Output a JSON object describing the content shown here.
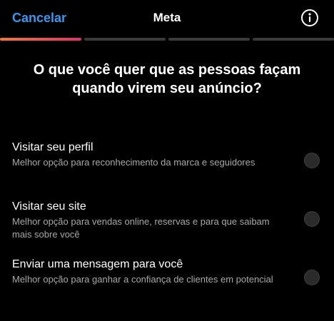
{
  "header": {
    "cancel_label": "Cancelar",
    "title": "Meta",
    "info_icon": "info-circle-icon"
  },
  "progress": {
    "total_steps": 4,
    "current_step": 1,
    "active_gradient": [
      "#f77737",
      "#e1306c"
    ],
    "inactive_color": "#3a3a3a"
  },
  "question": "O que você quer que as pessoas façam quando virem seu anúncio?",
  "options": [
    {
      "title": "Visitar seu perfil",
      "description": "Melhor opção para reconhecimento da marca e seguidores",
      "selected": false
    },
    {
      "title": "Visitar seu site",
      "description": "Melhor opção para vendas online, reservas e para que saibam mais sobre você",
      "selected": false
    },
    {
      "title": "Enviar uma mensagem para você",
      "description": "Melhor opção para ganhar a confiança de clientes em potencial",
      "selected": false
    }
  ],
  "colors": {
    "background": "#000000",
    "accent": "#3797f0",
    "secondary_text": "#a8a8a8"
  }
}
